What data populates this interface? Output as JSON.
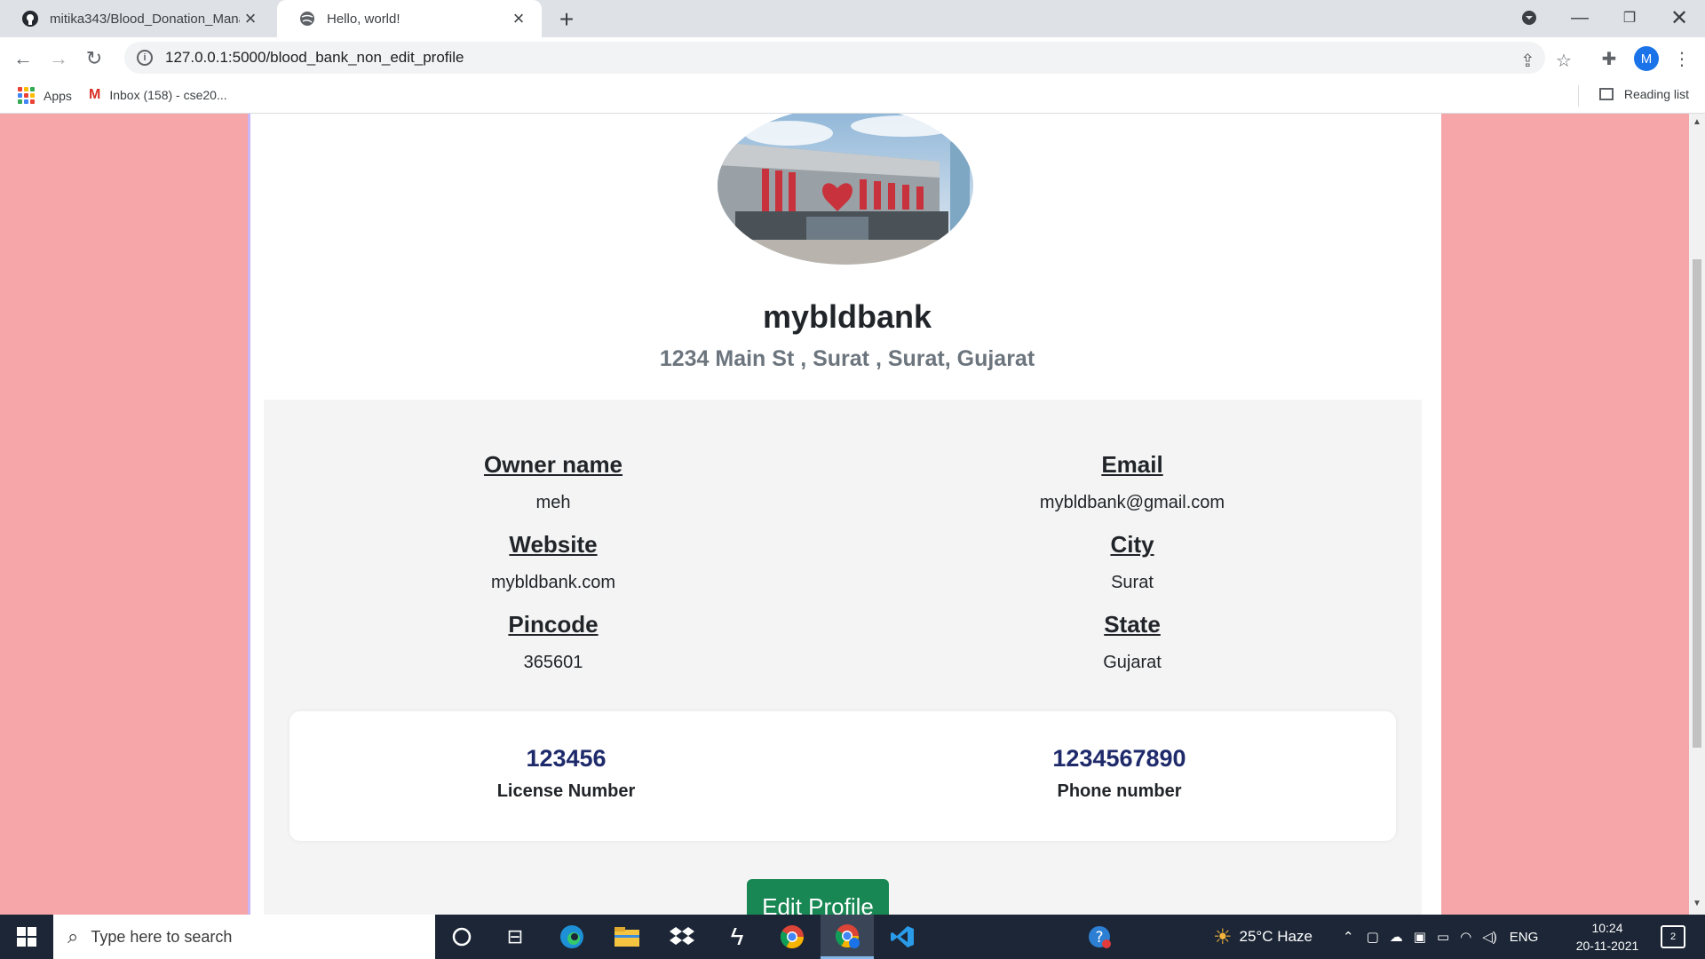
{
  "browser": {
    "tabs": [
      {
        "title": "mitika343/Blood_Donation_Mana",
        "icon": "github-icon"
      },
      {
        "title": "Hello, world!",
        "icon": "globe-icon"
      }
    ],
    "url": "127.0.0.1:5000/blood_bank_non_edit_profile",
    "profile_initial": "M",
    "bookmarks": [
      {
        "label": "Apps",
        "icon": "apps-grid-icon"
      },
      {
        "label": "Inbox (158) - cse20...",
        "icon": "gmail-icon"
      }
    ],
    "reading_list": "Reading list"
  },
  "profile": {
    "name": "mybldbank",
    "address": "1234 Main St , Surat , Surat, Gujarat",
    "fields": {
      "owner": {
        "label": "Owner name",
        "value": "meh"
      },
      "email": {
        "label": "Email",
        "value": "mybldbank@gmail.com"
      },
      "website": {
        "label": "Website",
        "value": "mybldbank.com"
      },
      "city": {
        "label": "City",
        "value": "Surat"
      },
      "pincode": {
        "label": "Pincode",
        "value": "365601"
      },
      "state": {
        "label": "State",
        "value": "Gujarat"
      }
    },
    "stats": {
      "license": {
        "number": "123456",
        "label": "License Number"
      },
      "phone": {
        "number": "1234567890",
        "label": "Phone number"
      }
    },
    "edit_button": "Edit Profile"
  },
  "taskbar": {
    "search_placeholder": "Type here to search",
    "weather": "25°C  Haze",
    "language": "ENG",
    "time": "10:24",
    "date": "20-11-2021",
    "notifications": "2"
  },
  "colors": {
    "page_background": "#f6a5a8",
    "edit_button": "#198754",
    "stat_number": "#1f2a6b"
  }
}
